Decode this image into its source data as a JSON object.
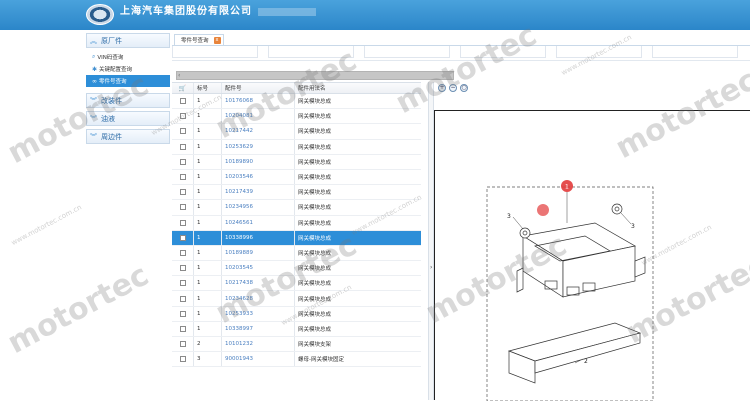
{
  "header": {
    "company_name": "上海汽车集团股份有限公司"
  },
  "sidebar": {
    "sections": [
      {
        "label": "原厂件",
        "expanded": true
      },
      {
        "label": "改装件",
        "expanded": false
      },
      {
        "label": "油液",
        "expanded": false
      },
      {
        "label": "周边件",
        "expanded": false
      }
    ],
    "sub_items": [
      {
        "label": "VIN码查询",
        "icon": "search-icon",
        "active": false
      },
      {
        "label": "关键配置查询",
        "icon": "gear-icon",
        "active": false
      },
      {
        "label": "零件号查询",
        "icon": "link-icon",
        "active": true
      }
    ]
  },
  "tabs": [
    {
      "label": "零件号查询",
      "close": "x"
    }
  ],
  "grid": {
    "headers": {
      "cart": "🛒",
      "index": "标号",
      "part_no": "配件号",
      "usage": "配件用法名"
    },
    "rows": [
      {
        "index": "1",
        "part_no": "10176068",
        "usage": "网关模块总成",
        "selected": false
      },
      {
        "index": "1",
        "part_no": "10204081",
        "usage": "网关模块总成",
        "selected": false
      },
      {
        "index": "1",
        "part_no": "10217442",
        "usage": "网关模块总成",
        "selected": false
      },
      {
        "index": "1",
        "part_no": "10253629",
        "usage": "网关模块总成",
        "selected": false
      },
      {
        "index": "1",
        "part_no": "10189890",
        "usage": "网关模块总成",
        "selected": false
      },
      {
        "index": "1",
        "part_no": "10203546",
        "usage": "网关模块总成",
        "selected": false
      },
      {
        "index": "1",
        "part_no": "10217439",
        "usage": "网关模块总成",
        "selected": false
      },
      {
        "index": "1",
        "part_no": "10234956",
        "usage": "网关模块总成",
        "selected": false
      },
      {
        "index": "1",
        "part_no": "10246561",
        "usage": "网关模块总成",
        "selected": false
      },
      {
        "index": "1",
        "part_no": "10338996",
        "usage": "网关模块总成",
        "selected": true
      },
      {
        "index": "1",
        "part_no": "10189889",
        "usage": "网关模块总成",
        "selected": false
      },
      {
        "index": "1",
        "part_no": "10203545",
        "usage": "网关模块总成",
        "selected": false
      },
      {
        "index": "1",
        "part_no": "10217438",
        "usage": "网关模块总成",
        "selected": false
      },
      {
        "index": "1",
        "part_no": "10234628",
        "usage": "网关模块总成",
        "selected": false
      },
      {
        "index": "1",
        "part_no": "10253933",
        "usage": "网关模块总成",
        "selected": false
      },
      {
        "index": "1",
        "part_no": "10338997",
        "usage": "网关模块总成",
        "selected": false
      },
      {
        "index": "2",
        "part_no": "10101232",
        "usage": "网关模块支架",
        "selected": false
      },
      {
        "index": "3",
        "part_no": "90001943",
        "usage": "螺母-网关模块固定",
        "selected": false
      }
    ]
  },
  "diagram": {
    "callouts": [
      "1",
      "2",
      "3",
      "3"
    ]
  },
  "watermark": {
    "text": "motortec",
    "domain": "www.motortec.com.cn"
  },
  "colors": {
    "header_blue": "#2b86c9",
    "selection_blue": "#2d8ed8",
    "callout_red": "#e23b3b",
    "tab_close_orange": "#e8843b"
  }
}
